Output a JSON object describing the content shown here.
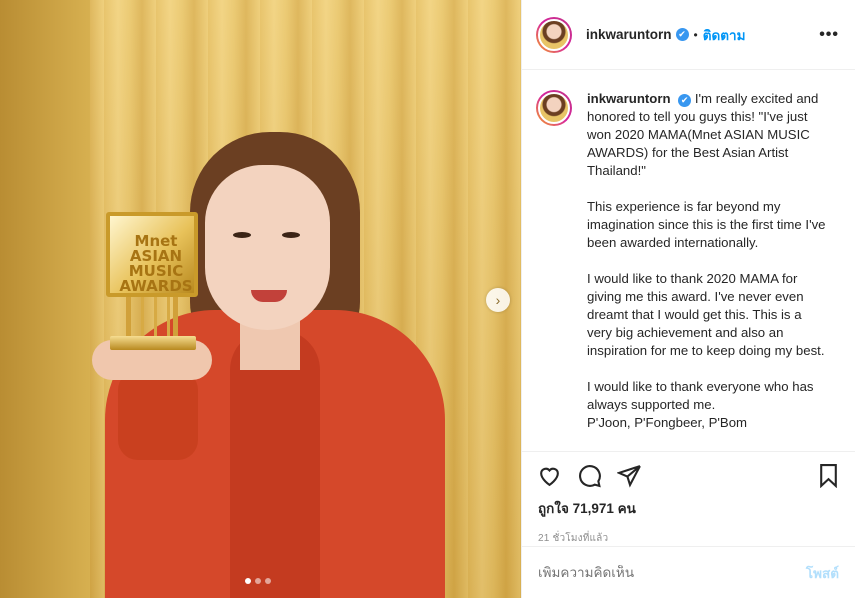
{
  "post": {
    "username": "inkwaruntorn",
    "verified_icon": "✔",
    "separator": "•",
    "follow_label": "ติดตาม",
    "more_label": "•••"
  },
  "caption": {
    "username": "inkwaruntorn",
    "text": "I'm really excited and honored to tell you guys this! \"I've just won 2020 MAMA(Mnet ASIAN MUSIC AWARDS) for the Best Asian Artist Thailand!\"\n\nThis experience is far beyond my imagination since this is the first time I've been awarded internationally.\n\nI would like to thank 2020 MAMA for giving me this award. I've never even dreamt that I would get this. This is a very big achievement and also an inspiration for me to keep doing my best.\n\nI would like to thank everyone who has always supported me.\nP'Joon, P'Fongbeer, P'Bom"
  },
  "trophy_text": "Mnet ASIAN MUSIC AWARDS",
  "likes_text": "ถูกใจ 71,971 คน",
  "timestamp": "21 ชั่วโมงที่แล้ว",
  "comment": {
    "placeholder": "เพิ่มความคิดเห็น",
    "post_label": "โพสต์"
  },
  "carousel": {
    "next_icon": "›",
    "total": 3,
    "active": 1
  },
  "colors": {
    "accent": "#0095f6",
    "verified": "#3897f0",
    "jacket": "#d5482a",
    "curtain": "#e9c66a"
  },
  "icons": [
    "heart-icon",
    "comment-icon",
    "share-icon",
    "bookmark-icon",
    "chevron-right-icon",
    "more-icon",
    "verified-icon"
  ]
}
